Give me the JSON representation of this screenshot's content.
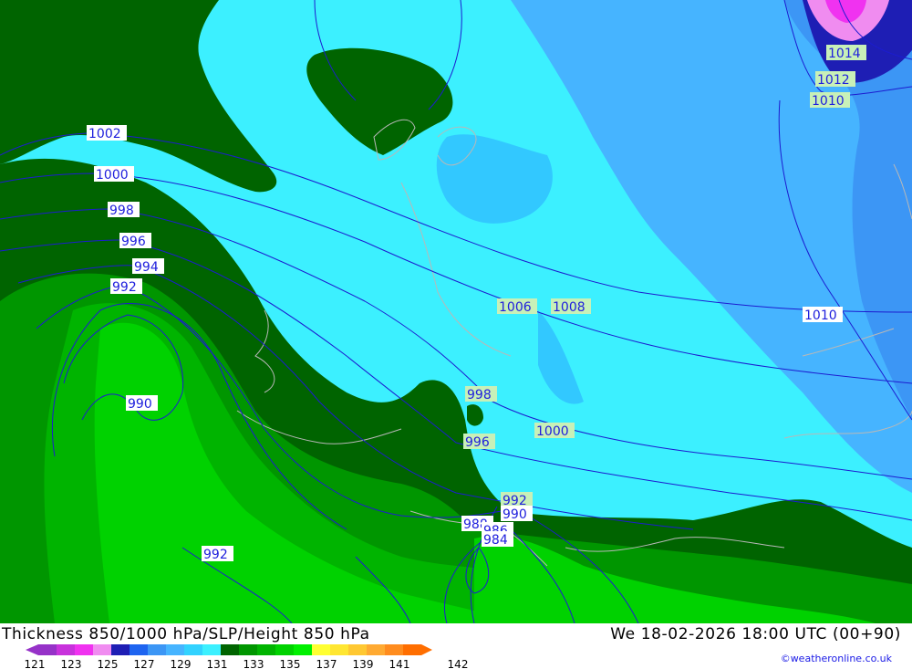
{
  "map": {
    "isobar_labels": [
      {
        "id": "p1002a",
        "text": "1002",
        "style": "blue"
      },
      {
        "id": "p1000a",
        "text": "1000",
        "style": "blue"
      },
      {
        "id": "p998a",
        "text": "998",
        "style": "blue"
      },
      {
        "id": "p996a",
        "text": "996",
        "style": "blue"
      },
      {
        "id": "p994a",
        "text": "994",
        "style": "blue"
      },
      {
        "id": "p992a",
        "text": "992",
        "style": "blue"
      },
      {
        "id": "p990a",
        "text": "990",
        "style": "blue"
      },
      {
        "id": "p992b",
        "text": "992",
        "style": "blue"
      },
      {
        "id": "p1006",
        "text": "1006",
        "style": "green"
      },
      {
        "id": "p1008",
        "text": "1008",
        "style": "green"
      },
      {
        "id": "p1010a",
        "text": "1010",
        "style": "blue"
      },
      {
        "id": "p1014",
        "text": "1014",
        "style": "green"
      },
      {
        "id": "p1012",
        "text": "1012",
        "style": "green"
      },
      {
        "id": "p1010b",
        "text": "1010",
        "style": "green"
      },
      {
        "id": "p998b",
        "text": "998",
        "style": "green"
      },
      {
        "id": "p996b",
        "text": "996",
        "style": "green"
      },
      {
        "id": "p1000b",
        "text": "1000",
        "style": "green"
      },
      {
        "id": "p992c",
        "text": "992",
        "style": "green"
      },
      {
        "id": "p990b",
        "text": "990",
        "style": "blue"
      },
      {
        "id": "p988",
        "text": "988",
        "style": "blue"
      },
      {
        "id": "p986",
        "text": "986",
        "style": "blue"
      },
      {
        "id": "p984",
        "text": "984",
        "style": "blue"
      }
    ],
    "label_bg": {
      "blue": "#ffffff",
      "green": "#c8f0b8"
    },
    "label_fg": {
      "blue": "#2020dd",
      "green": "#2020dd"
    }
  },
  "footer": {
    "title": "Thickness 850/1000 hPa/SLP/Height 850 hPa",
    "datetime": "We 18-02-2026 18:00 UTC (00+90)",
    "credit": "©weatheronline.co.uk"
  },
  "legend": {
    "colors": [
      "#9632c8",
      "#c832dc",
      "#f032f0",
      "#f08cf0",
      "#1e1eb4",
      "#1e64f0",
      "#3c96f5",
      "#46b4ff",
      "#32d2ff",
      "#3cf0ff",
      "#006400",
      "#009600",
      "#00b400",
      "#00d200",
      "#00f000",
      "#ffff32",
      "#ffe632",
      "#ffc832",
      "#ffaa32",
      "#ff8c1e",
      "#ff6e00"
    ],
    "ticks": [
      "121",
      "123",
      "125",
      "127",
      "129",
      "131",
      "133",
      "135",
      "137",
      "139",
      "141",
      "142"
    ]
  }
}
